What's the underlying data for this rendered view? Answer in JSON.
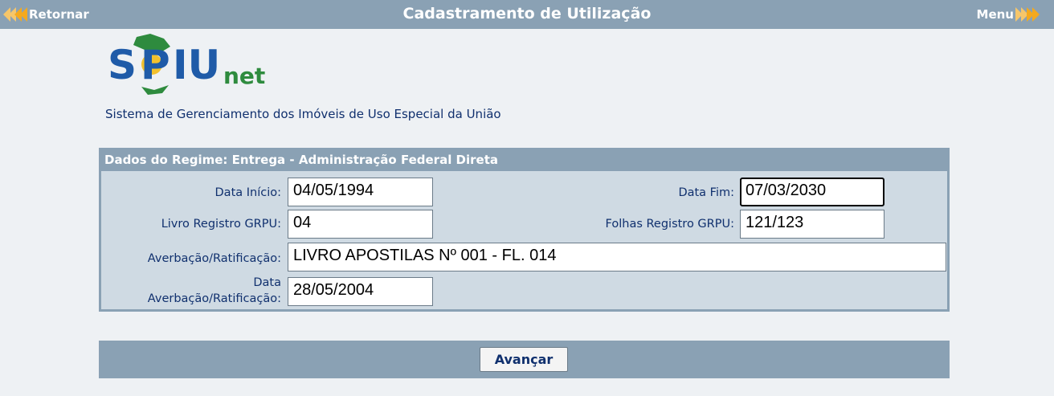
{
  "header": {
    "title": "Cadastramento de Utilização",
    "back_label": "Retornar",
    "menu_label": "Menu"
  },
  "logo": {
    "text_main": "SPIU",
    "text_suffix": "net",
    "colors": {
      "blue": "#1f5ba8",
      "green": "#2e8b3e",
      "yellow": "#f2c12e"
    }
  },
  "subtitle": "Sistema de Gerenciamento dos Imóveis de Uso Especial da União",
  "panel": {
    "header": "Dados do Regime: Entrega - Administração Federal Direta",
    "fields": {
      "data_inicio": {
        "label": "Data Início:",
        "value": "04/05/1994"
      },
      "data_fim": {
        "label": "Data Fim:",
        "value": "07/03/2030"
      },
      "livro_registro": {
        "label": "Livro Registro GRPU:",
        "value": "04"
      },
      "folhas_registro": {
        "label": "Folhas Registro GRPU:",
        "value": "121/123"
      },
      "averbacao": {
        "label": "Averbação/Ratificação:",
        "value": "LIVRO APOSTILAS Nº 001 - FL. 014"
      },
      "data_averbacao": {
        "label_line1": "Data",
        "label_line2": "Averbação/Ratificação:",
        "value": "28/05/2004"
      }
    }
  },
  "footer": {
    "button_label": "Avançar"
  }
}
